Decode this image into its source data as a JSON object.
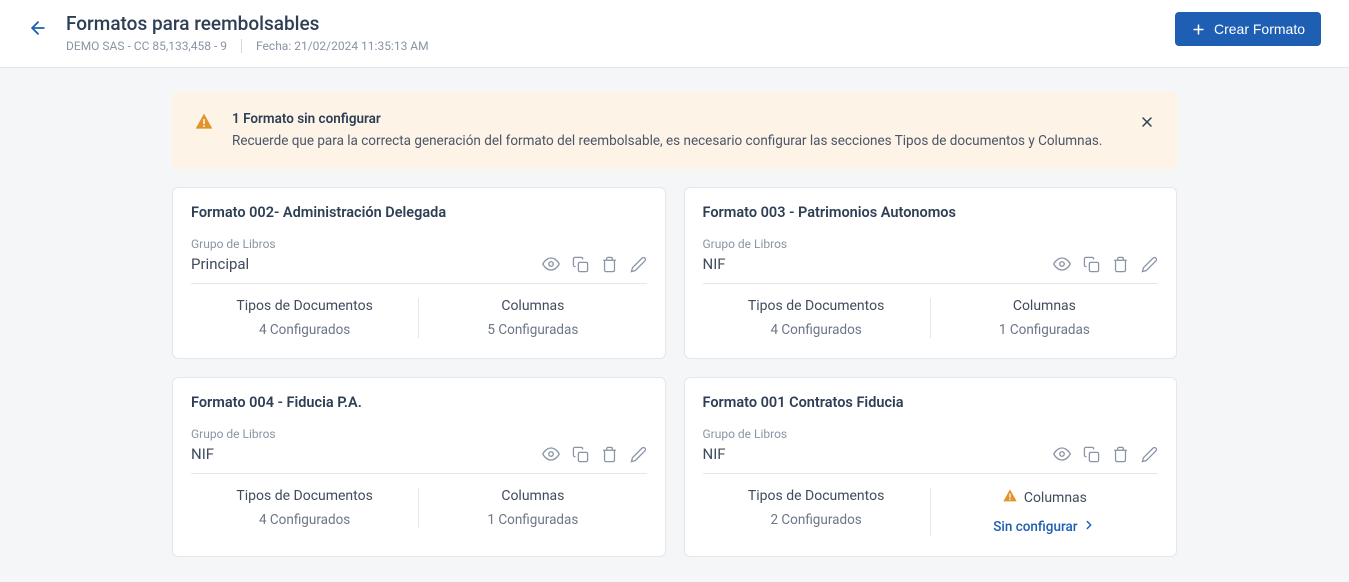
{
  "header": {
    "title": "Formatos para reembolsables",
    "subtitle_company": "DEMO SAS - CC 85,133,458 - 9",
    "subtitle_date": "Fecha: 21/02/2024 11:35:13 AM",
    "create_button": "Crear Formato"
  },
  "alert": {
    "title": "1 Formato sin configurar",
    "body": "Recuerde que para la correcta generación del formato del reembolsable, es necesario configurar las secciones Tipos de documentos y Columnas."
  },
  "labels": {
    "grupo_libros": "Grupo de Libros",
    "tipos_documentos": "Tipos de Documentos",
    "columnas": "Columnas",
    "sin_configurar": "Sin configurar"
  },
  "cards": [
    {
      "title": "Formato 002- Administración Delegada",
      "group": "Principal",
      "tipos": "4 Configurados",
      "columnas": "5 Configuradas",
      "warn": false
    },
    {
      "title": "Formato 003 - Patrimonios Autonomos",
      "group": "NIF",
      "tipos": "4 Configurados",
      "columnas": "1 Configuradas",
      "warn": false
    },
    {
      "title": "Formato 004 - Fiducia P.A.",
      "group": "NIF",
      "tipos": "4 Configurados",
      "columnas": "1 Configuradas",
      "warn": false
    },
    {
      "title": "Formato 001 Contratos Fiducia",
      "group": "NIF",
      "tipos": "2 Configurados",
      "columnas": "",
      "warn": true
    }
  ]
}
